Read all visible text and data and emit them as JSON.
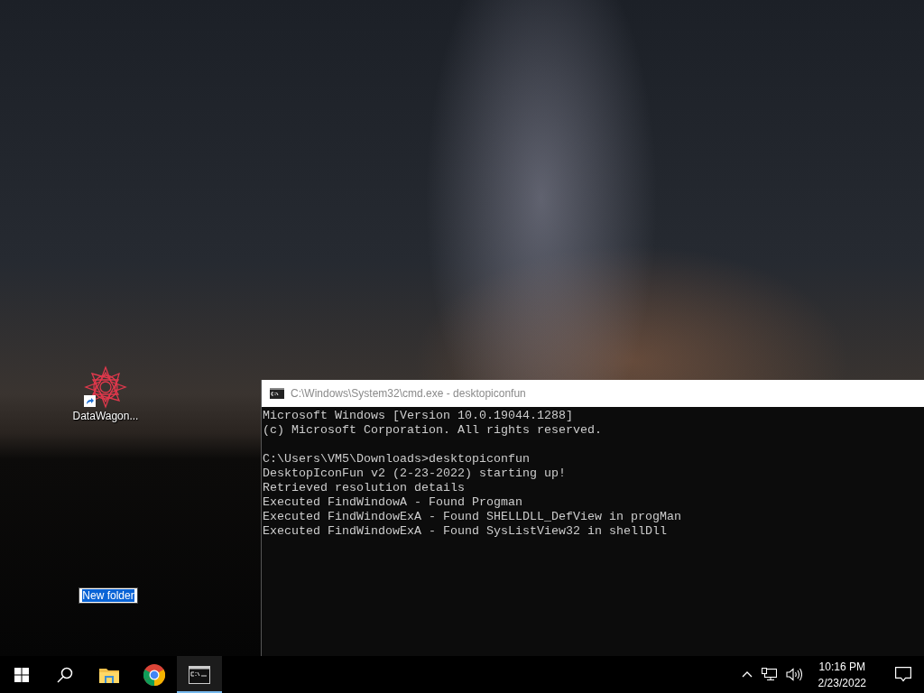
{
  "desktop": {
    "icons": [
      {
        "label": "DataWagon...",
        "kind": "shortcut"
      },
      {
        "label": "New folder",
        "kind": "renaming"
      }
    ]
  },
  "console": {
    "title": "C:\\Windows\\System32\\cmd.exe - desktopiconfun",
    "active": false,
    "blocks": [
      [
        "Microsoft Windows [Version 10.0.19044.1288]",
        "(c) Microsoft Corporation. All rights reserved."
      ],
      [
        "C:\\Users\\VM5\\Downloads>desktopiconfun",
        "DesktopIconFun v2 (2-23-2022) starting up!",
        "Retrieved resolution details",
        "Executed FindWindowA - Found Progman",
        "Executed FindWindowExA - Found SHELLDLL_DefView in progMan",
        "Executed FindWindowExA - Found SysListView32 in shellDll"
      ]
    ]
  },
  "taskbar": {
    "apps": [
      {
        "kind": "start",
        "active": false
      },
      {
        "kind": "search",
        "active": false
      },
      {
        "kind": "explorer",
        "active": false
      },
      {
        "kind": "browser",
        "active": false
      },
      {
        "kind": "terminal",
        "active": true
      }
    ],
    "clock": {
      "time": "10:16 PM",
      "date": "2/23/2022"
    }
  }
}
